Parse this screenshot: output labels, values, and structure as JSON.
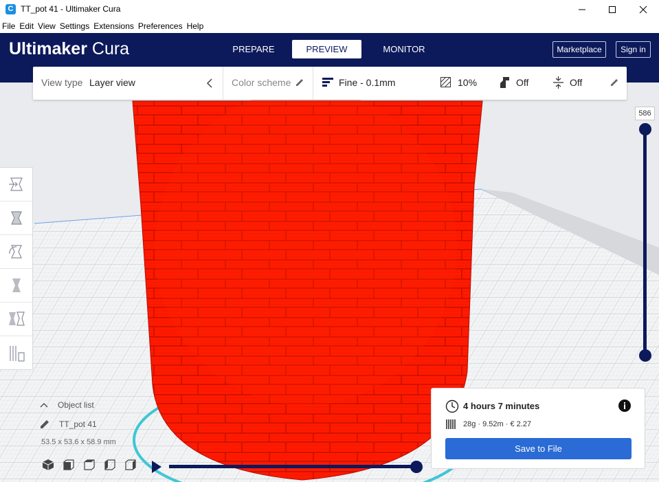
{
  "window": {
    "title": "TT_pot 41  - Ultimaker Cura",
    "app_icon": "C"
  },
  "menu": [
    "File",
    "Edit",
    "View",
    "Settings",
    "Extensions",
    "Preferences",
    "Help"
  ],
  "header": {
    "brand_bold": "Ultimaker",
    "brand_light": " Cura",
    "tabs": [
      {
        "label": "PREPARE",
        "active": false
      },
      {
        "label": "PREVIEW",
        "active": true
      },
      {
        "label": "MONITOR",
        "active": false
      }
    ],
    "marketplace_label": "Marketplace",
    "signin_label": "Sign in"
  },
  "viewbar": {
    "view_type_label": "View type",
    "view_type_value": "Layer view",
    "color_scheme_label": "Color scheme",
    "profile": "Fine - 0.1mm",
    "infill": "10%",
    "support": "Off",
    "adhesion": "Off"
  },
  "layer_slider": {
    "value": "586"
  },
  "object_list": {
    "label": "Object list",
    "object_name": "TT_pot 41",
    "dimensions": "53.5 x 53.6 x 58.9 mm"
  },
  "print_info": {
    "time": "4 hours 7 minutes",
    "material": "28g · 9.52m · € 2.27",
    "save_label": "Save to File"
  },
  "colors": {
    "brand": "#0c1a5b",
    "accent": "#2a6bd6",
    "model": "#ff1a00",
    "platform_ring": "#3fc6d6"
  }
}
